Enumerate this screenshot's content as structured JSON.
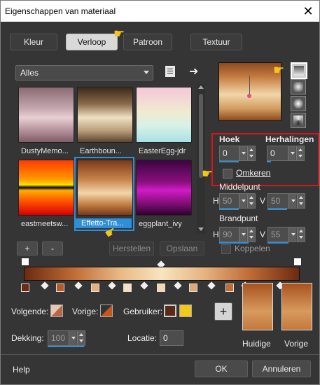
{
  "window": {
    "title": "Eigenschappen van materiaal",
    "close_glyph": "✕"
  },
  "tabs": [
    {
      "label": "Kleur"
    },
    {
      "label": "Verloop"
    },
    {
      "label": "Patroon"
    },
    {
      "label": "Textuur"
    }
  ],
  "filter": {
    "selected": "Alles"
  },
  "gradients": [
    {
      "label": "DustyMemo..."
    },
    {
      "label": "Earthboun..."
    },
    {
      "label": "EasterEgg-jdr"
    },
    {
      "label": "eastmeetsw..."
    },
    {
      "label": "Effetto-Tra..."
    },
    {
      "label": "eggplant_ivy"
    }
  ],
  "list_buttons": {
    "add": "+",
    "remove": "-",
    "reset": "Herstellen",
    "save": "Opslaan"
  },
  "angle": {
    "label": "Hoek",
    "value": "0"
  },
  "repeats": {
    "label": "Herhalingen",
    "value": "0"
  },
  "invert": {
    "label": "Omkeren"
  },
  "center": {
    "label": "Middelpunt",
    "h_label": "H",
    "h_value": "50",
    "v_label": "V",
    "v_value": "50"
  },
  "focal": {
    "label": "Brandpunt",
    "h_label": "H",
    "h_value": "90",
    "v_label": "V",
    "v_value": "55"
  },
  "link": {
    "label": "Koppelen"
  },
  "stop_editor": {
    "foreground_label": "Volgende:",
    "background_label": "Vorige:",
    "user_label": "Gebruiker:",
    "opacity_label": "Dekking:",
    "opacity_value": "100",
    "location_label": "Locatie:",
    "location_value": "0"
  },
  "swatches": {
    "add": "+",
    "current_label": "Huidige",
    "previous_label": "Vorige"
  },
  "footer": {
    "help": "Help",
    "ok": "OK",
    "cancel": "Annuleren"
  },
  "colors": {
    "accent": "#2f8ed8",
    "highlight_box": "#d9151b",
    "gradient_dark": "#7a3a1a",
    "gradient_light": "#f1d6a8",
    "user_color": "#f2c81a"
  }
}
